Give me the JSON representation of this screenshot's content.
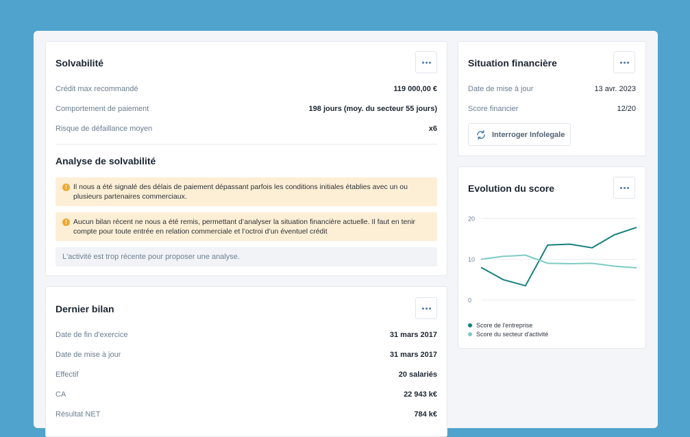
{
  "colors": {
    "background": "#4fa3cc",
    "accent_link": "#4b79a8",
    "series_company": "#137f7b",
    "series_sector": "#7ccbc2",
    "alert_bg": "#fdefd6",
    "alert_icon": "#f0a830"
  },
  "solvabilite": {
    "title": "Solvabilité",
    "rows": [
      {
        "label": "Crédit max recommandé",
        "value": "119 000,00 €"
      },
      {
        "label": "Comportement de paiement",
        "value": "198 jours (moy. du secteur 55 jours)"
      },
      {
        "label": "Risque de défaillance moyen",
        "value": "x6"
      }
    ],
    "analysis_title": "Analyse de solvabilité",
    "alerts": [
      "Il nous a été signalé des délais de paiement dépassant parfois les conditions initiales établies avec un ou plusieurs partenaires commerciaux.",
      "Aucun bilan récent ne nous a été remis, permettant d’analyser la situation financière actuelle. Il faut en tenir compte pour toute entrée en relation commerciale et l’octroi d’un éventuel crédit"
    ],
    "note": "L'activité est trop récente pour proposer une analyse."
  },
  "dernier_bilan": {
    "title": "Dernier bilan",
    "rows": [
      {
        "label": "Date de fin d'exercice",
        "value": "31 mars 2017"
      },
      {
        "label": "Date de mise à jour",
        "value": "31 mars 2017"
      },
      {
        "label": "Effectif",
        "value": "20 salariés"
      },
      {
        "label": "CA",
        "value": "22 943 k€"
      },
      {
        "label": "Résultat NET",
        "value": "784 k€"
      }
    ]
  },
  "situation": {
    "title": "Situation financière",
    "rows": [
      {
        "label": "Date de mise à jour",
        "value": "13 avr. 2023"
      },
      {
        "label": "Score financier",
        "value": "12/20"
      }
    ],
    "button_label": "Interroger Infolegale",
    "button_icon": "refresh-icon"
  },
  "evolution": {
    "title": "Evolution du score"
  },
  "chart_data": {
    "type": "line",
    "ylim": [
      0,
      20
    ],
    "yticks": [
      "0",
      "10",
      "20"
    ],
    "grid": true,
    "legend_position": "bottom-left",
    "series": [
      {
        "name": "Score de l'entreprise",
        "values": [
          8,
          5,
          3.5,
          13.5,
          13.7,
          12.8,
          16,
          17.8
        ]
      },
      {
        "name": "Score du secteur d'activité",
        "values": [
          10,
          10.7,
          11,
          9,
          8.9,
          9,
          8.3,
          7.9
        ]
      }
    ]
  }
}
